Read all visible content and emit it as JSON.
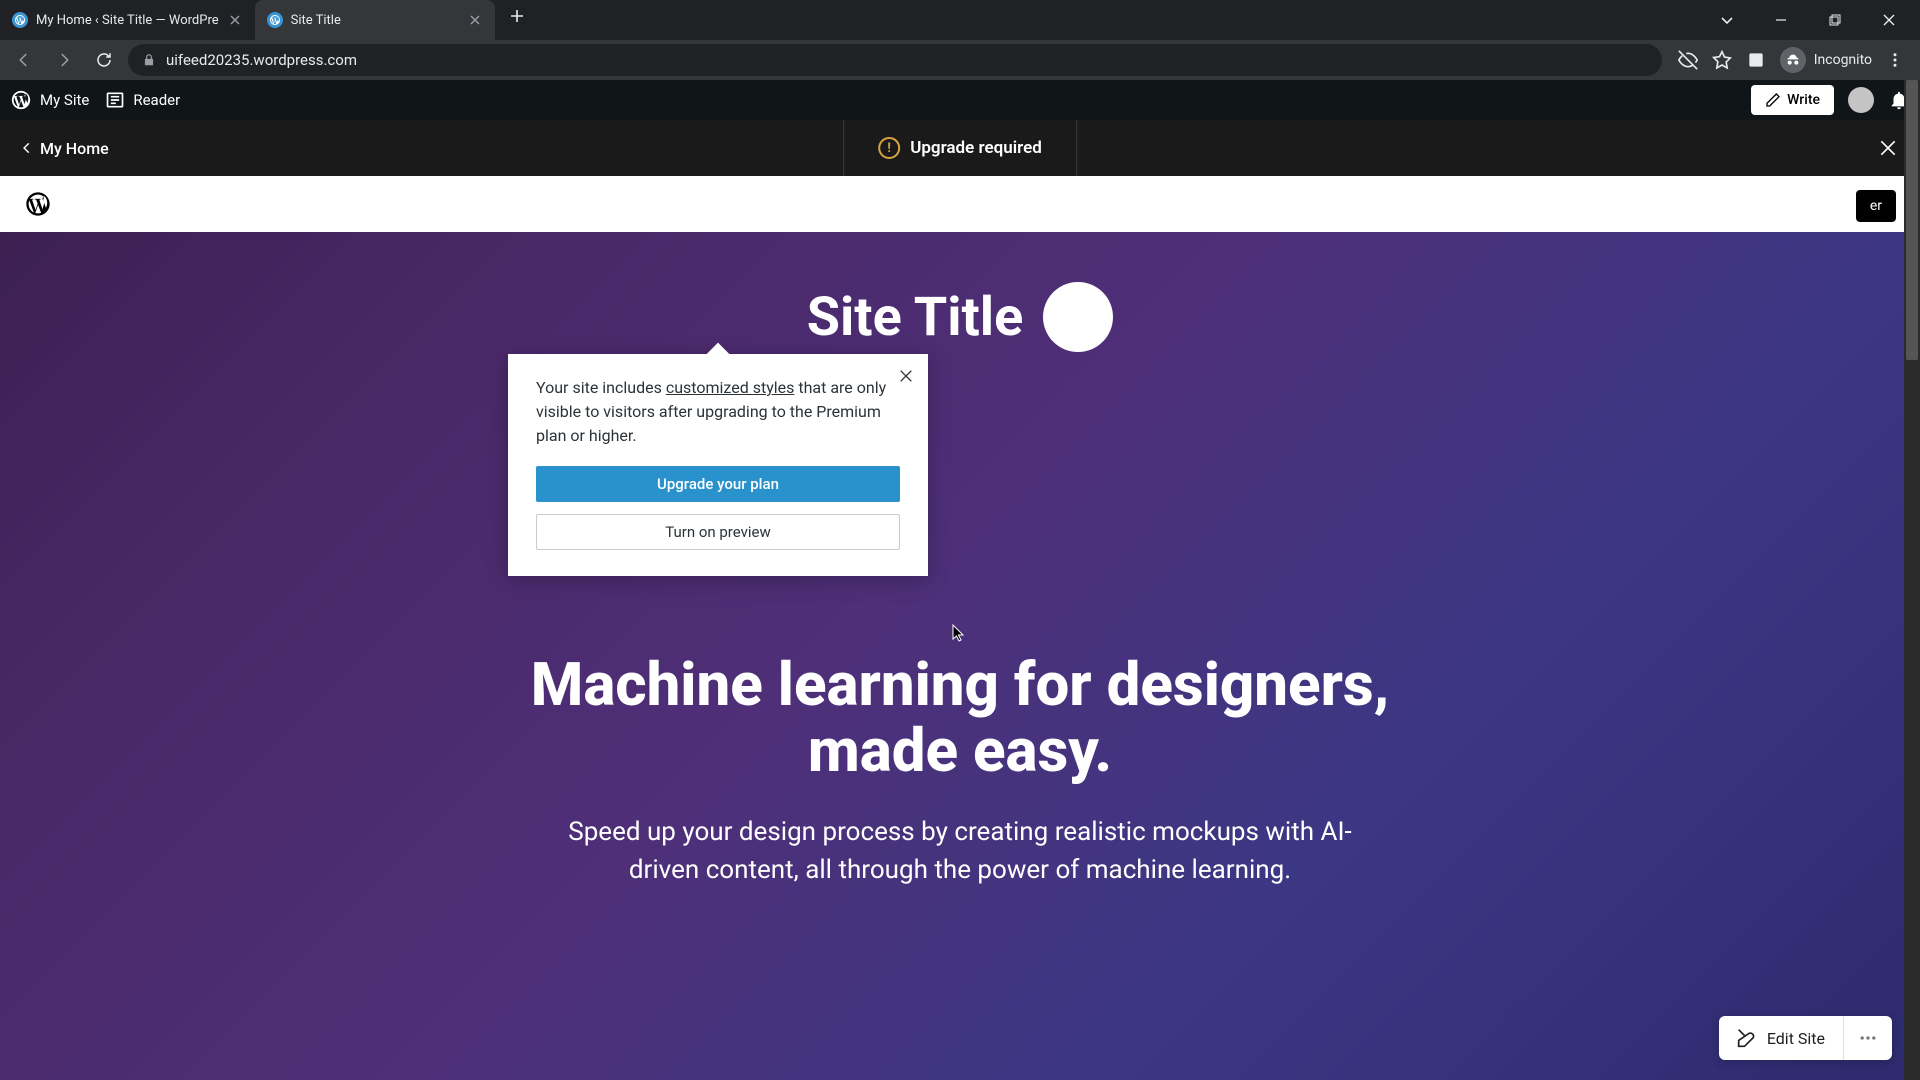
{
  "browser": {
    "tabs": [
      {
        "title": "My Home ‹ Site Title — WordPre",
        "active": false
      },
      {
        "title": "Site Title",
        "active": true
      }
    ],
    "url": "uifeed20235.wordpress.com",
    "incognito_label": "Incognito"
  },
  "wp_bar": {
    "my_site": "My Site",
    "reader": "Reader",
    "write": "Write"
  },
  "upgrade_bar": {
    "back_label": "My Home",
    "title": "Upgrade required"
  },
  "popover": {
    "text_before": "Your site includes ",
    "link_text": "customized styles",
    "text_after": " that are only visible to visitors after upgrading to the Premium plan or higher.",
    "primary": "Upgrade your plan",
    "secondary": "Turn on preview"
  },
  "hero": {
    "site_title": "Site Title",
    "heading": "Machine learning for designers, made easy.",
    "sub": "Speed up your design process by creating realistic mockups with AI-driven content, all through the power of machine learning."
  },
  "site_header": {
    "button": "er"
  },
  "edit_site": {
    "label": "Edit Site"
  }
}
